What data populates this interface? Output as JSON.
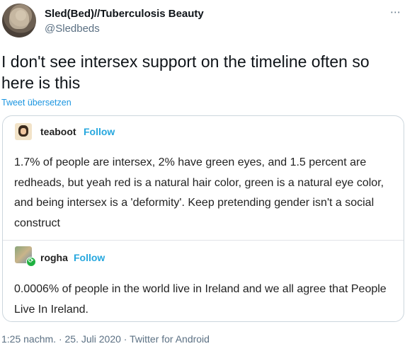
{
  "tweet": {
    "display_name": "Sled(Bed)//Tuberculosis Beauty",
    "handle": "@Sledbeds",
    "more_icon": "⋯",
    "text": "I don't see intersex support on the timeline often so here is this",
    "translate_label": "Tweet übersetzen"
  },
  "embedded": {
    "post1": {
      "username": "teaboot",
      "follow_label": "Follow",
      "text": "1.7% of people are intersex, 2% have green eyes, and 1.5 percent are redheads, but yeah red is a natural hair color, green is a natural eye color, and being intersex is a 'deformity'. Keep pretending gender isn't a social construct"
    },
    "post2": {
      "username": "rogha",
      "follow_label": "Follow",
      "reblog_icon": "⟳",
      "text": "0.0006% of people in the world live in Ireland and we all agree that People Live In Ireland."
    }
  },
  "meta": {
    "time": "1:25 nachm.",
    "sep1": " · ",
    "date": "25. Juli 2020",
    "sep2": " · ",
    "source": "Twitter for Android"
  },
  "colors": {
    "follow": "#26a7de",
    "link": "#1b95e0",
    "secondary": "#5b7083"
  }
}
